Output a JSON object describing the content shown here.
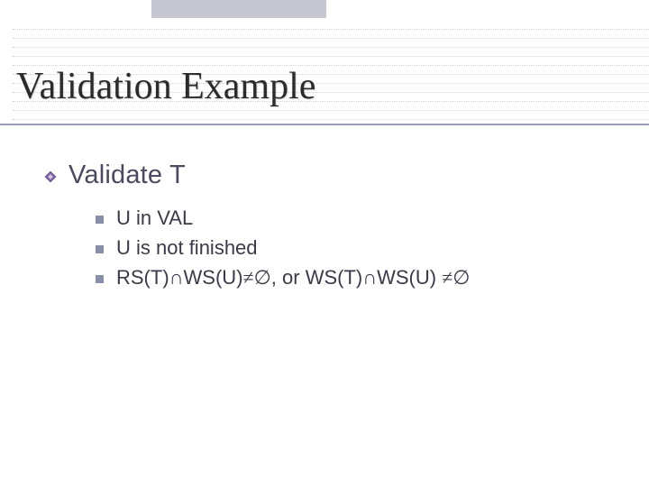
{
  "title": "Validation Example",
  "bullets": {
    "level1": [
      {
        "text": "Validate T"
      }
    ],
    "level2": [
      {
        "text": "U in VAL"
      },
      {
        "text": "U is not finished"
      },
      {
        "prefix": "RS(T)",
        "op1": "∩",
        "mid": "WS(U)",
        "neq1": "≠∅",
        "sep": ", or ",
        "prefix2": "WS(T)",
        "op2": "∩",
        "mid2": "WS(U) ",
        "neq2": "≠∅"
      }
    ]
  }
}
